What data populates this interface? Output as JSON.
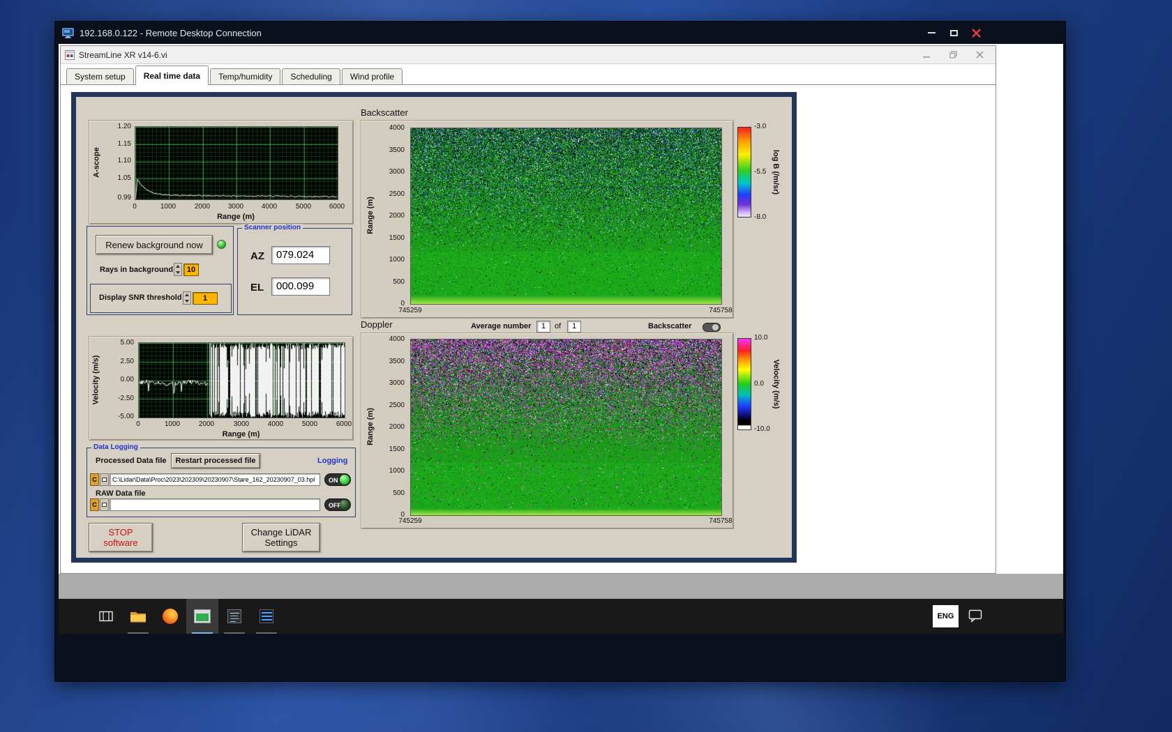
{
  "rdp": {
    "title": "192.168.0.122 - Remote Desktop Connection"
  },
  "app": {
    "title": "StreamLine XR v14-6.vi",
    "active_tab": "Real time data",
    "tabs": [
      {
        "label": "System setup"
      },
      {
        "label": "Real time data"
      },
      {
        "label": "Temp/humidity"
      },
      {
        "label": "Scheduling"
      },
      {
        "label": "Wind profile"
      }
    ]
  },
  "ascope": {
    "ylabel": "A-scope",
    "xlabel": "Range (m)",
    "yticks": [
      "1.20",
      "1.15",
      "1.10",
      "1.05",
      "0.99"
    ],
    "xticks": [
      "0",
      "1000",
      "2000",
      "3000",
      "4000",
      "5000",
      "6000"
    ]
  },
  "background_group": {
    "renew_button": "Renew background now",
    "rays_label": "Rays in background",
    "rays_value": "10",
    "snr_label": "Display SNR threshold",
    "snr_value": "1"
  },
  "scanner": {
    "label": "Scanner position",
    "az_label": "AZ",
    "az_value": "079.024",
    "el_label": "EL",
    "el_value": "000.099"
  },
  "backscatter": {
    "title": "Backscatter",
    "ylabel": "Range (m)",
    "yticks": [
      "4000",
      "3500",
      "3000",
      "2500",
      "2000",
      "1500",
      "1000",
      "500",
      "0"
    ],
    "x_left": "745259",
    "x_right": "745758",
    "colorbar": {
      "ticks": [
        "-3.0",
        "-5.5",
        "-8.0"
      ],
      "label": "log B (/m/sr)"
    }
  },
  "doppler": {
    "title": "Doppler",
    "ylabel": "Range (m)",
    "yticks": [
      "4000",
      "3500",
      "3000",
      "2500",
      "2000",
      "1500",
      "1000",
      "500",
      "0"
    ],
    "x_left": "745259",
    "x_right": "745758",
    "colorbar": {
      "ticks": [
        "10.0",
        "0.0",
        "-10.0"
      ],
      "label": "Velocity (m/s)"
    }
  },
  "average": {
    "label": "Average number",
    "value": "1",
    "of": "of",
    "total": "1"
  },
  "display_toggle": {
    "label": "Backscatter"
  },
  "velocity": {
    "ylabel": "Velocity (m/s)",
    "xlabel": "Range (m)",
    "yticks": [
      "5.00",
      "2.50",
      "0.00",
      "-2.50",
      "-5.00"
    ],
    "xticks": [
      "0",
      "1000",
      "2000",
      "3000",
      "4000",
      "5000",
      "6000"
    ]
  },
  "logging": {
    "label": "Data Logging",
    "processed_label": "Processed Data file",
    "restart_button": "Restart processed file",
    "logging_label": "Logging",
    "drive": "C",
    "processed_path": "C:\\Lidar\\Data\\Proc\\2023\\202309\\20230907\\Stare_162_20230907_03.hpl",
    "on": "ON",
    "raw_label": "RAW Data file",
    "raw_path": "",
    "off": "OFF"
  },
  "buttons": {
    "stop_line1": "STOP",
    "stop_line2": "software",
    "change_line1": "Change LiDAR",
    "change_line2": "Settings"
  },
  "taskbar": {
    "lang": "ENG"
  },
  "colors": {
    "panel": "#d6d0c4",
    "frame_navy": "#24355c",
    "orange_field": "#ffb400",
    "plot_green": "#28aa28"
  }
}
